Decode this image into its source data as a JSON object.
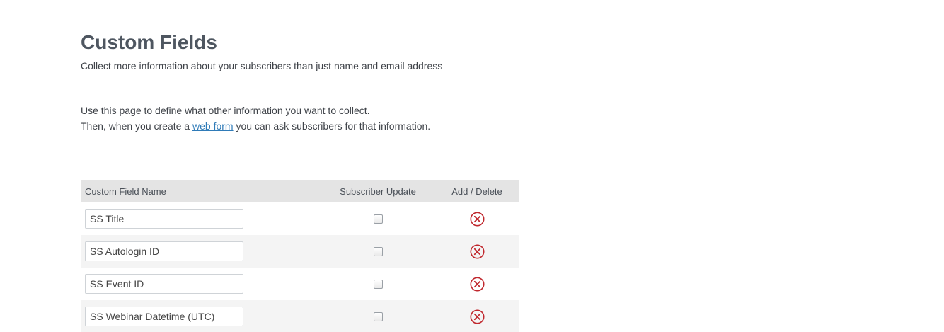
{
  "header": {
    "title": "Custom Fields",
    "subtitle": "Collect more information about your subscribers than just name and email address"
  },
  "intro": {
    "line1": "Use this page to define what other information you want to collect.",
    "line2_before": "Then, when you create a ",
    "line2_link": "web form",
    "line2_after": " you can ask subscribers for that information."
  },
  "table": {
    "columns": [
      "Custom Field Name",
      "Subscriber Update",
      "Add / Delete"
    ],
    "rows": [
      {
        "name": "SS Title",
        "subscriber_update": false
      },
      {
        "name": "SS Autologin ID",
        "subscriber_update": false
      },
      {
        "name": "SS Event ID",
        "subscriber_update": false
      },
      {
        "name": "SS Webinar Datetime (UTC)",
        "subscriber_update": false
      }
    ]
  },
  "icons": {
    "delete": "delete-circle-x-icon"
  },
  "colors": {
    "delete_red": "#c0282e",
    "link_blue": "#2f7bb8",
    "header_bg": "#e4e4e4",
    "alt_row_bg": "#f4f4f4"
  }
}
